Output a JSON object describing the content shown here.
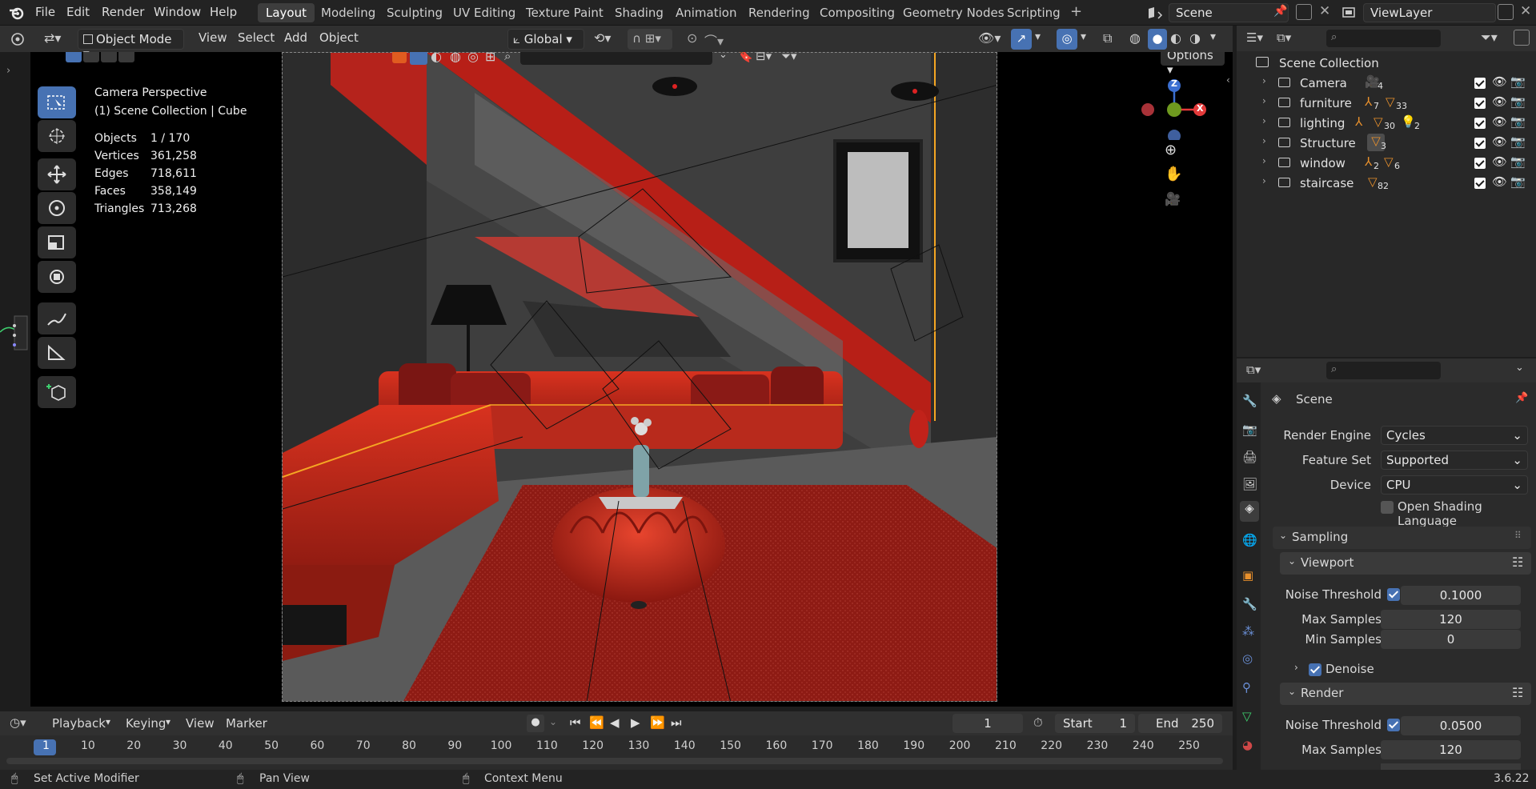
{
  "menubar": {
    "items": [
      "File",
      "Edit",
      "Render",
      "Window",
      "Help"
    ],
    "workspaces": [
      "Layout",
      "Modeling",
      "Sculpting",
      "UV Editing",
      "Texture Paint",
      "Shading",
      "Animation",
      "Rendering",
      "Compositing",
      "Geometry Nodes",
      "Scripting"
    ],
    "active_workspace": "Layout",
    "scene_name": "Scene",
    "view_layer": "ViewLayer"
  },
  "viewport_header": {
    "mode": "Object Mode",
    "menus": [
      "View",
      "Select",
      "Add",
      "Object"
    ],
    "transform_orientation": "Global",
    "options_label": "Options"
  },
  "viewport_overlay": {
    "view_name": "Camera Perspective",
    "collection": "(1) Scene Collection | Cube",
    "stats": [
      {
        "label": "Objects",
        "value": "1 / 170"
      },
      {
        "label": "Vertices",
        "value": "361,258"
      },
      {
        "label": "Edges",
        "value": "718,611"
      },
      {
        "label": "Faces",
        "value": "358,149"
      },
      {
        "label": "Triangles",
        "value": "713,268"
      }
    ],
    "gizmo": {
      "z": "Z",
      "x": "X"
    }
  },
  "outliner": {
    "root": "Scene Collection",
    "collections": [
      {
        "name": "Camera",
        "badges": [
          "4"
        ]
      },
      {
        "name": "furniture",
        "badges": [
          "7",
          "33"
        ]
      },
      {
        "name": "lighting",
        "badges": [
          "30",
          "2"
        ]
      },
      {
        "name": "Structure",
        "badges": [
          "3"
        ]
      },
      {
        "name": "window",
        "badges": [
          "2",
          "6"
        ]
      },
      {
        "name": "staircase",
        "badges": [
          "82"
        ]
      }
    ]
  },
  "properties": {
    "context": "Scene",
    "render_engine_label": "Render Engine",
    "render_engine": "Cycles",
    "feature_set_label": "Feature Set",
    "feature_set": "Supported",
    "device_label": "Device",
    "device": "CPU",
    "osl_label": "Open Shading Language",
    "sampling_label": "Sampling",
    "viewport_label": "Viewport",
    "noise_threshold_label": "Noise Threshold",
    "viewport_noise_threshold": "0.1000",
    "max_samples_label": "Max Samples",
    "viewport_max_samples": "120",
    "min_samples_label": "Min Samples",
    "viewport_min_samples": "0",
    "denoise_label": "Denoise",
    "render_label": "Render",
    "render_noise_threshold": "0.0500",
    "render_max_samples": "120"
  },
  "timeline": {
    "menus": [
      "Playback",
      "Keying",
      "View",
      "Marker"
    ],
    "current_frame": "1",
    "start_label": "Start",
    "start": "1",
    "end_label": "End",
    "end": "250",
    "ticks": [
      "1",
      "10",
      "20",
      "30",
      "40",
      "50",
      "60",
      "70",
      "80",
      "90",
      "100",
      "110",
      "120",
      "130",
      "140",
      "150",
      "160",
      "170",
      "180",
      "190",
      "200",
      "210",
      "220",
      "230",
      "240",
      "250"
    ]
  },
  "statusbar": {
    "left": "Set Active Modifier",
    "middle": "Pan View",
    "right": "Context Menu",
    "version": "3.6.22"
  },
  "colors": {
    "accent": "#4772b3",
    "sofa_red": "#c0281e",
    "selection_orange": "#f5a623"
  }
}
